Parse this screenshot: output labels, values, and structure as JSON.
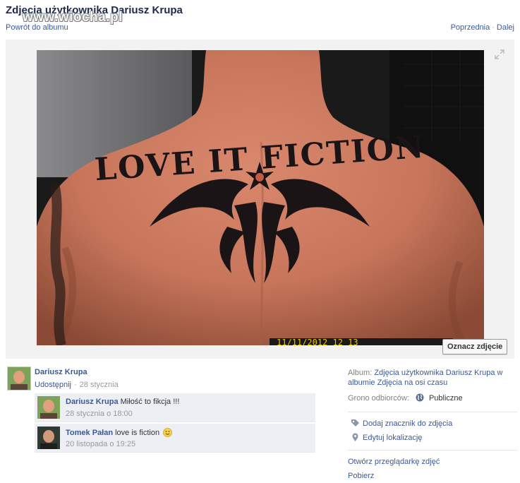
{
  "header": {
    "title": "Zdjęcia użytkownika Dariusz Krupa",
    "back_link": "Powrót do albumu",
    "prev_link": "Poprzednia",
    "separator": "·",
    "next_link": "Dalej"
  },
  "watermark": "www.wiocha.pl",
  "photo": {
    "tattoo_text": "LOVE IT FICTION",
    "tag_button": "Oznacz zdjęcie"
  },
  "owner": {
    "name": "Dariusz Krupa",
    "share_link": "Udostępnij",
    "meta_sep": "·",
    "date": "28 stycznia"
  },
  "comments": [
    {
      "author": "Dariusz Krupa",
      "text": "Miłość to fikcja !!!",
      "time": "28 stycznia o 18:00"
    },
    {
      "author": "Tomek Pałan",
      "text": "love is fiction",
      "time": "20 listopada o 19:25"
    }
  ],
  "sidebar": {
    "album_label": "Album:",
    "album_link": "Zdjęcia użytkownika Dariusz Krupa w albumie Zdjęcia na osi czasu",
    "audience_label": "Grono odbiorców:",
    "audience_value": "Publiczne",
    "actions": [
      {
        "label": "Dodaj znacznik do zdjęcia",
        "icon": "tag-icon"
      },
      {
        "label": "Edytuj lokalizację",
        "icon": "location-pin-icon"
      }
    ],
    "viewer_link": "Otwórz przeglądarkę zdjęć",
    "download_link": "Pobierz"
  },
  "colors": {
    "link": "#3b5998",
    "title": "#1c2a47",
    "comment_bg": "#edeff4",
    "stage_bg": "#f2f2f2"
  }
}
